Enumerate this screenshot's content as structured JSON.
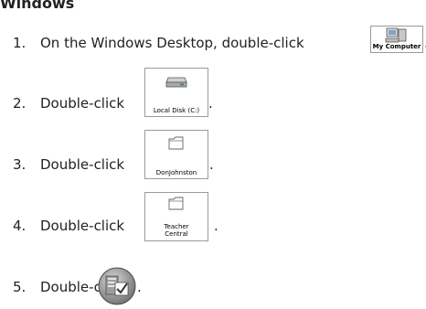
{
  "heading": "Windows",
  "steps": [
    {
      "number": "1.",
      "text": "On the Windows Desktop, double-click",
      "icon_label": "My Computer",
      "icon": "my-computer-icon",
      "suffix": "."
    },
    {
      "number": "2.",
      "text": "Double-click",
      "icon_label": "Local Disk (C:)",
      "icon": "local-disk-icon",
      "suffix": "."
    },
    {
      "number": "3.",
      "text": "Double-click",
      "icon_label": "DonJohnston",
      "icon": "folder-icon",
      "suffix": "."
    },
    {
      "number": "4.",
      "text": "Double-click",
      "icon_label": "Teacher Central",
      "icon": "folder-icon",
      "suffix": "."
    },
    {
      "number": "5.",
      "text": "Double-click",
      "icon_label": "",
      "icon": "teacher-central-app-icon",
      "suffix": "."
    }
  ]
}
